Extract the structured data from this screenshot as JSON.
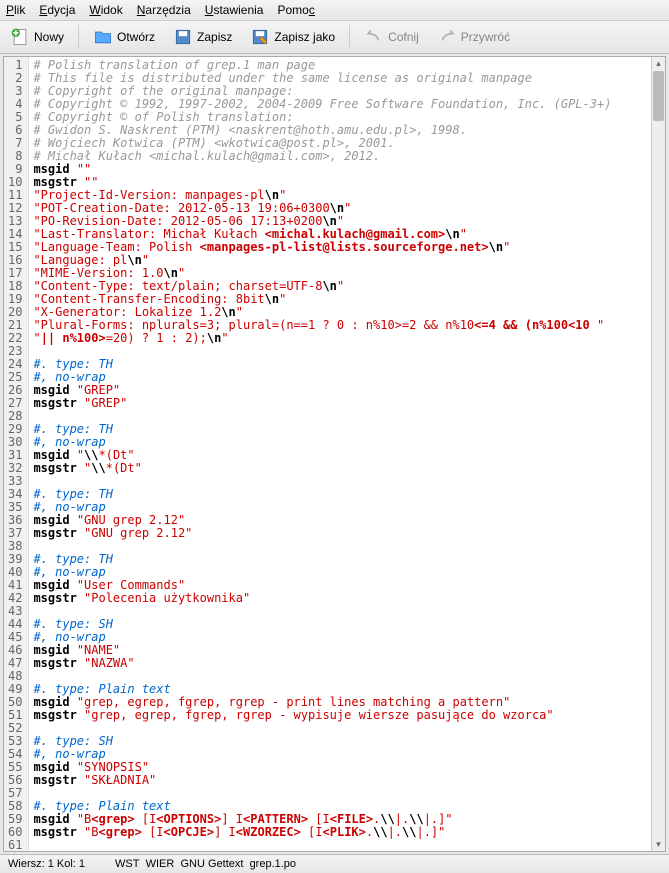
{
  "menu": {
    "plik": "Plik",
    "edycja": "Edycja",
    "widok": "Widok",
    "narzedzia": "Narzędzia",
    "ustawienia": "Ustawienia",
    "pomoc": "Pomoc"
  },
  "toolbar": {
    "nowy": "Nowy",
    "otworz": "Otwórz",
    "zapisz": "Zapisz",
    "zapiszjako": "Zapisz jako",
    "cofnij": "Cofnij",
    "przywroc": "Przywróć"
  },
  "lines": [
    {
      "n": 1,
      "seg": [
        {
          "t": "# Polish translation of grep.1 man page",
          "c": "c-comment"
        }
      ]
    },
    {
      "n": 2,
      "seg": [
        {
          "t": "# This file is distributed under the same license as original manpage",
          "c": "c-comment"
        }
      ]
    },
    {
      "n": 3,
      "seg": [
        {
          "t": "# Copyright of the original manpage:",
          "c": "c-comment"
        }
      ]
    },
    {
      "n": 4,
      "seg": [
        {
          "t": "# Copyright © 1992, 1997-2002, 2004-2009 Free Software Foundation, Inc. (GPL-3+)",
          "c": "c-comment"
        }
      ]
    },
    {
      "n": 5,
      "seg": [
        {
          "t": "# Copyright © of Polish translation:",
          "c": "c-comment"
        }
      ]
    },
    {
      "n": 6,
      "seg": [
        {
          "t": "# Gwidon S. Naskrent (PTM) <naskrent@hoth.amu.edu.pl>, 1998.",
          "c": "c-comment"
        }
      ]
    },
    {
      "n": 7,
      "seg": [
        {
          "t": "# Wojciech Kotwica (PTM) <wkotwica@post.pl>, 2001.",
          "c": "c-comment"
        }
      ]
    },
    {
      "n": 8,
      "seg": [
        {
          "t": "# Michał Kułach <michal.kulach@gmail.com>, 2012.",
          "c": "c-comment"
        }
      ]
    },
    {
      "n": 9,
      "seg": [
        {
          "t": "msgid ",
          "c": "c-keyword"
        },
        {
          "t": "\"\"",
          "c": "c-string"
        }
      ]
    },
    {
      "n": 10,
      "seg": [
        {
          "t": "msgstr ",
          "c": "c-keyword"
        },
        {
          "t": "\"\"",
          "c": "c-string"
        }
      ]
    },
    {
      "n": 11,
      "seg": [
        {
          "t": "\"Project-Id-Version: manpages-pl",
          "c": "c-string"
        },
        {
          "t": "\\n",
          "c": "c-bold"
        },
        {
          "t": "\"",
          "c": "c-string"
        }
      ]
    },
    {
      "n": 12,
      "seg": [
        {
          "t": "\"POT-Creation-Date: 2012-05-13 19:06+0300",
          "c": "c-string"
        },
        {
          "t": "\\n",
          "c": "c-bold"
        },
        {
          "t": "\"",
          "c": "c-string"
        }
      ]
    },
    {
      "n": 13,
      "seg": [
        {
          "t": "\"PO-Revision-Date: 2012-05-06 17:13+0200",
          "c": "c-string"
        },
        {
          "t": "\\n",
          "c": "c-bold"
        },
        {
          "t": "\"",
          "c": "c-string"
        }
      ]
    },
    {
      "n": 14,
      "seg": [
        {
          "t": "\"Last-Translator: Michał Kułach ",
          "c": "c-string"
        },
        {
          "t": "<michal.kulach@gmail.com>",
          "c": "c-string c-bold"
        },
        {
          "t": "\\n",
          "c": "c-bold"
        },
        {
          "t": "\"",
          "c": "c-string"
        }
      ]
    },
    {
      "n": 15,
      "seg": [
        {
          "t": "\"Language-Team: Polish ",
          "c": "c-string"
        },
        {
          "t": "<manpages-pl-list@lists.sourceforge.net>",
          "c": "c-string c-bold"
        },
        {
          "t": "\\n",
          "c": "c-bold"
        },
        {
          "t": "\"",
          "c": "c-string"
        }
      ]
    },
    {
      "n": 16,
      "seg": [
        {
          "t": "\"Language: pl",
          "c": "c-string"
        },
        {
          "t": "\\n",
          "c": "c-bold"
        },
        {
          "t": "\"",
          "c": "c-string"
        }
      ]
    },
    {
      "n": 17,
      "seg": [
        {
          "t": "\"MIME-Version: 1.0",
          "c": "c-string"
        },
        {
          "t": "\\n",
          "c": "c-bold"
        },
        {
          "t": "\"",
          "c": "c-string"
        }
      ]
    },
    {
      "n": 18,
      "seg": [
        {
          "t": "\"Content-Type: text/plain; charset=UTF-8",
          "c": "c-string"
        },
        {
          "t": "\\n",
          "c": "c-bold"
        },
        {
          "t": "\"",
          "c": "c-string"
        }
      ]
    },
    {
      "n": 19,
      "seg": [
        {
          "t": "\"Content-Transfer-Encoding: 8bit",
          "c": "c-string"
        },
        {
          "t": "\\n",
          "c": "c-bold"
        },
        {
          "t": "\"",
          "c": "c-string"
        }
      ]
    },
    {
      "n": 20,
      "seg": [
        {
          "t": "\"X-Generator: Lokalize 1.2",
          "c": "c-string"
        },
        {
          "t": "\\n",
          "c": "c-bold"
        },
        {
          "t": "\"",
          "c": "c-string"
        }
      ]
    },
    {
      "n": 21,
      "seg": [
        {
          "t": "\"Plural-Forms: nplurals=3; plural=(n==1 ? 0 : n%10>=2 && n%10",
          "c": "c-string"
        },
        {
          "t": "<=4 && (n%100<10 ",
          "c": "c-string c-bold"
        },
        {
          "t": "\"",
          "c": "c-string"
        }
      ]
    },
    {
      "n": 22,
      "seg": [
        {
          "t": "\"",
          "c": "c-string"
        },
        {
          "t": "|| n%100>",
          "c": "c-string c-bold"
        },
        {
          "t": "=20) ? 1 : 2);",
          "c": "c-string"
        },
        {
          "t": "\\n",
          "c": "c-bold"
        },
        {
          "t": "\"",
          "c": "c-string"
        }
      ]
    },
    {
      "n": 23,
      "seg": []
    },
    {
      "n": 24,
      "seg": [
        {
          "t": "#. type: TH",
          "c": "c-blue"
        }
      ]
    },
    {
      "n": 25,
      "seg": [
        {
          "t": "#, no-wrap",
          "c": "c-blue"
        }
      ]
    },
    {
      "n": 26,
      "seg": [
        {
          "t": "msgid ",
          "c": "c-keyword"
        },
        {
          "t": "\"GREP\"",
          "c": "c-string"
        }
      ]
    },
    {
      "n": 27,
      "seg": [
        {
          "t": "msgstr ",
          "c": "c-keyword"
        },
        {
          "t": "\"GREP\"",
          "c": "c-string"
        }
      ]
    },
    {
      "n": 28,
      "seg": []
    },
    {
      "n": 29,
      "seg": [
        {
          "t": "#. type: TH",
          "c": "c-blue"
        }
      ]
    },
    {
      "n": 30,
      "seg": [
        {
          "t": "#, no-wrap",
          "c": "c-blue"
        }
      ]
    },
    {
      "n": 31,
      "seg": [
        {
          "t": "msgid ",
          "c": "c-keyword"
        },
        {
          "t": "\"",
          "c": "c-string"
        },
        {
          "t": "\\\\",
          "c": "c-bold"
        },
        {
          "t": "*(Dt\"",
          "c": "c-string"
        }
      ]
    },
    {
      "n": 32,
      "seg": [
        {
          "t": "msgstr ",
          "c": "c-keyword"
        },
        {
          "t": "\"",
          "c": "c-string"
        },
        {
          "t": "\\\\",
          "c": "c-bold"
        },
        {
          "t": "*(Dt\"",
          "c": "c-string"
        }
      ]
    },
    {
      "n": 33,
      "seg": []
    },
    {
      "n": 34,
      "seg": [
        {
          "t": "#. type: TH",
          "c": "c-blue"
        }
      ]
    },
    {
      "n": 35,
      "seg": [
        {
          "t": "#, no-wrap",
          "c": "c-blue"
        }
      ]
    },
    {
      "n": 36,
      "seg": [
        {
          "t": "msgid ",
          "c": "c-keyword"
        },
        {
          "t": "\"GNU grep 2.12\"",
          "c": "c-string"
        }
      ]
    },
    {
      "n": 37,
      "seg": [
        {
          "t": "msgstr ",
          "c": "c-keyword"
        },
        {
          "t": "\"GNU grep 2.12\"",
          "c": "c-string"
        }
      ]
    },
    {
      "n": 38,
      "seg": []
    },
    {
      "n": 39,
      "seg": [
        {
          "t": "#. type: TH",
          "c": "c-blue"
        }
      ]
    },
    {
      "n": 40,
      "seg": [
        {
          "t": "#, no-wrap",
          "c": "c-blue"
        }
      ]
    },
    {
      "n": 41,
      "seg": [
        {
          "t": "msgid ",
          "c": "c-keyword"
        },
        {
          "t": "\"User Commands\"",
          "c": "c-string"
        }
      ]
    },
    {
      "n": 42,
      "seg": [
        {
          "t": "msgstr ",
          "c": "c-keyword"
        },
        {
          "t": "\"Polecenia użytkownika\"",
          "c": "c-string"
        }
      ]
    },
    {
      "n": 43,
      "seg": []
    },
    {
      "n": 44,
      "seg": [
        {
          "t": "#. type: SH",
          "c": "c-blue"
        }
      ]
    },
    {
      "n": 45,
      "seg": [
        {
          "t": "#, no-wrap",
          "c": "c-blue"
        }
      ]
    },
    {
      "n": 46,
      "seg": [
        {
          "t": "msgid ",
          "c": "c-keyword"
        },
        {
          "t": "\"NAME\"",
          "c": "c-string"
        }
      ]
    },
    {
      "n": 47,
      "seg": [
        {
          "t": "msgstr ",
          "c": "c-keyword"
        },
        {
          "t": "\"NAZWA\"",
          "c": "c-string"
        }
      ]
    },
    {
      "n": 48,
      "seg": []
    },
    {
      "n": 49,
      "seg": [
        {
          "t": "#. type: Plain text",
          "c": "c-blue"
        }
      ]
    },
    {
      "n": 50,
      "seg": [
        {
          "t": "msgid ",
          "c": "c-keyword"
        },
        {
          "t": "\"grep, egrep, fgrep, rgrep - print lines matching a pattern\"",
          "c": "c-string"
        }
      ]
    },
    {
      "n": 51,
      "seg": [
        {
          "t": "msgstr ",
          "c": "c-keyword"
        },
        {
          "t": "\"grep, egrep, fgrep, rgrep - wypisuje wiersze pasujące do wzorca\"",
          "c": "c-string"
        }
      ]
    },
    {
      "n": 52,
      "seg": []
    },
    {
      "n": 53,
      "seg": [
        {
          "t": "#. type: SH",
          "c": "c-blue"
        }
      ]
    },
    {
      "n": 54,
      "seg": [
        {
          "t": "#, no-wrap",
          "c": "c-blue"
        }
      ]
    },
    {
      "n": 55,
      "seg": [
        {
          "t": "msgid ",
          "c": "c-keyword"
        },
        {
          "t": "\"SYNOPSIS\"",
          "c": "c-string"
        }
      ]
    },
    {
      "n": 56,
      "seg": [
        {
          "t": "msgstr ",
          "c": "c-keyword"
        },
        {
          "t": "\"SKŁADNIA\"",
          "c": "c-string"
        }
      ]
    },
    {
      "n": 57,
      "seg": []
    },
    {
      "n": 58,
      "seg": [
        {
          "t": "#. type: Plain text",
          "c": "c-blue"
        }
      ]
    },
    {
      "n": 59,
      "seg": [
        {
          "t": "msgid ",
          "c": "c-keyword"
        },
        {
          "t": "\"B",
          "c": "c-string"
        },
        {
          "t": "<grep>",
          "c": "c-string c-bold"
        },
        {
          "t": " [I",
          "c": "c-string"
        },
        {
          "t": "<OPTIONS>",
          "c": "c-string c-bold"
        },
        {
          "t": "] I",
          "c": "c-string"
        },
        {
          "t": "<PATTERN>",
          "c": "c-string c-bold"
        },
        {
          "t": " [I",
          "c": "c-string"
        },
        {
          "t": "<FILE>",
          "c": "c-string c-bold"
        },
        {
          "t": ".",
          "c": "c-string"
        },
        {
          "t": "\\\\",
          "c": "c-bold"
        },
        {
          "t": "|.",
          "c": "c-string"
        },
        {
          "t": "\\\\",
          "c": "c-bold"
        },
        {
          "t": "|.]\"",
          "c": "c-string"
        }
      ]
    },
    {
      "n": 60,
      "seg": [
        {
          "t": "msgstr ",
          "c": "c-keyword"
        },
        {
          "t": "\"B",
          "c": "c-string"
        },
        {
          "t": "<grep>",
          "c": "c-string c-bold"
        },
        {
          "t": " [I",
          "c": "c-string"
        },
        {
          "t": "<OPCJE>",
          "c": "c-string c-bold"
        },
        {
          "t": "] I",
          "c": "c-string"
        },
        {
          "t": "<WZORZEC>",
          "c": "c-string c-bold"
        },
        {
          "t": " [I",
          "c": "c-string"
        },
        {
          "t": "<PLIK>",
          "c": "c-string c-bold"
        },
        {
          "t": ".",
          "c": "c-string"
        },
        {
          "t": "\\\\",
          "c": "c-bold"
        },
        {
          "t": "|.",
          "c": "c-string"
        },
        {
          "t": "\\\\",
          "c": "c-bold"
        },
        {
          "t": "|.]\"",
          "c": "c-string"
        }
      ]
    },
    {
      "n": 61,
      "seg": []
    }
  ],
  "status": {
    "pos": "Wiersz: 1 Kol: 1",
    "mode1": "WST",
    "mode2": "WIER",
    "filetype": "GNU Gettext",
    "filename": "grep.1.po"
  }
}
